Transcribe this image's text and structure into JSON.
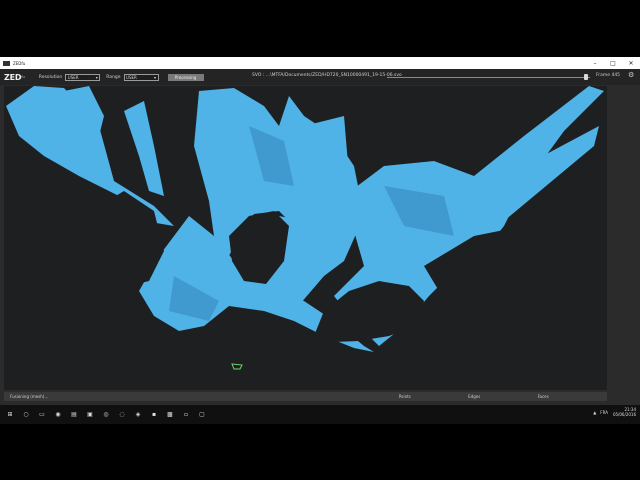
{
  "window": {
    "title": "ZEDfu",
    "controls": {
      "minimize": "–",
      "maximize": "□",
      "close": "✕"
    }
  },
  "toolbar": {
    "logo": "ZED",
    "logo_sub": "fu",
    "resolution_label": "Resolution",
    "resolution_value": "USER",
    "range_label": "Range",
    "range_value": "USER",
    "processing_button": "Processing",
    "svo_path": "SVO : ...\\MTFA/Documents/ZED/HD720_SN10000491_19-15-06.svo",
    "frame_label": "Frame 445",
    "settings_icon": "gear-icon"
  },
  "playback": {
    "progress": 0.98
  },
  "viewport": {
    "mesh_color": "#4fb3e8",
    "background_color": "#1e1f21"
  },
  "statusbar": {
    "left": "Fusioning (mesh)...",
    "points_label": "Points",
    "edges_label": "Edges",
    "faces_label": "Faces"
  },
  "taskbar": {
    "icons": [
      "windows-icon",
      "search-icon",
      "task-view-icon",
      "chrome-icon",
      "file-explorer-icon",
      "store-icon",
      "steam-icon",
      "app-icon",
      "app-icon-2",
      "app-icon-3",
      "zed-app-icon",
      "app-icon-4",
      "app-icon-5"
    ],
    "tray_lang": "FRA",
    "time": "21:34",
    "date": "05/06/2016"
  }
}
